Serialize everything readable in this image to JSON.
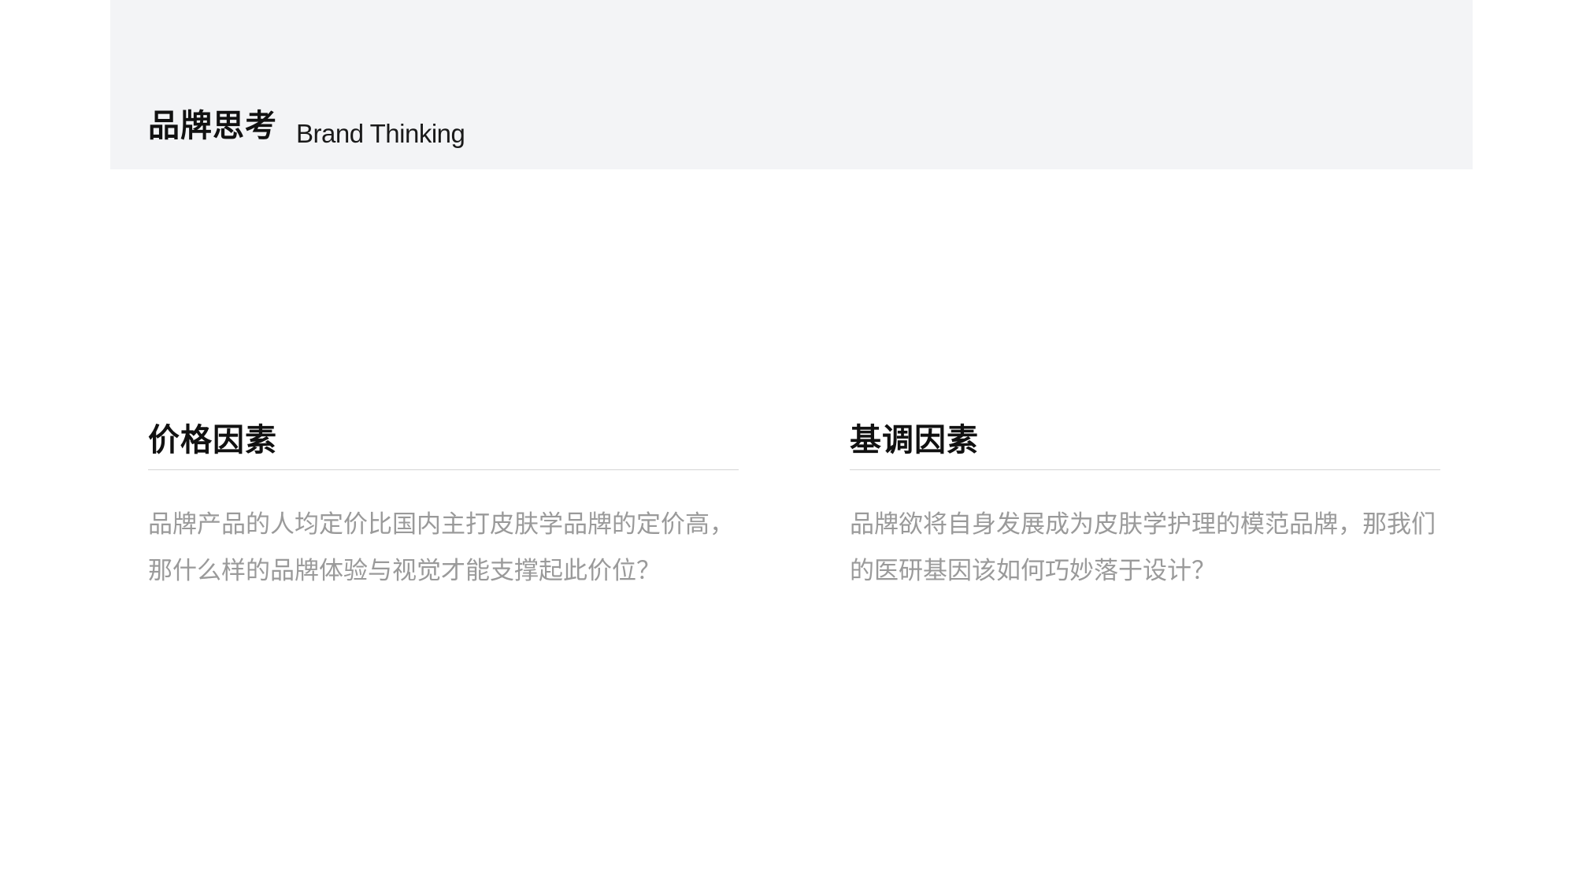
{
  "header": {
    "title_zh": "品牌思考",
    "title_en": "Brand Thinking"
  },
  "sections": [
    {
      "heading": "价格因素",
      "body": "品牌产品的人均定价比国内主打皮肤学品牌的定价高，那什么样的品牌体验与视觉才能支撑起此价位？"
    },
    {
      "heading": "基调因素",
      "body": "品牌欲将自身发展成为皮肤学护理的模范品牌，那我们的医研基因该如何巧妙落于设计？"
    }
  ]
}
